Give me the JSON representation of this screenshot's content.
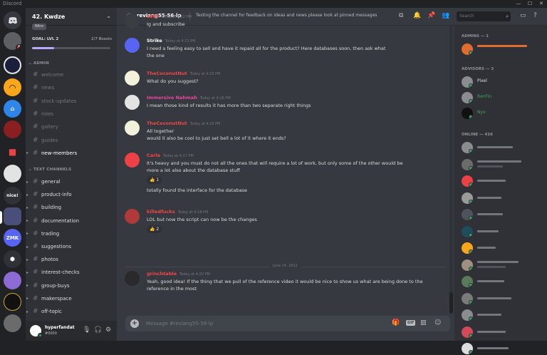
{
  "window": {
    "title": "Discord"
  },
  "server": {
    "name": "42. Kwdze",
    "boost_label": "Nitro",
    "goal_label": "GOAL: LVL 2",
    "goal_count": "2/7 Boosts",
    "goal_progress": 0.28
  },
  "categories": {
    "admin": "ADMIN",
    "text": "TEXT CHANNELS"
  },
  "admin_channels": [
    {
      "label": "welcome",
      "state": "muted"
    },
    {
      "label": "news",
      "state": "muted"
    },
    {
      "label": "stock-updates",
      "state": "muted"
    },
    {
      "label": "roles",
      "state": "muted"
    },
    {
      "label": "gallery",
      "state": "muted"
    },
    {
      "label": "guides",
      "state": "muted"
    },
    {
      "label": "new-members",
      "state": "unread"
    }
  ],
  "text_channels": [
    {
      "label": "general"
    },
    {
      "label": "product-info"
    },
    {
      "label": "building"
    },
    {
      "label": "documentation"
    },
    {
      "label": "trading"
    },
    {
      "label": "suggestions"
    },
    {
      "label": "photos"
    },
    {
      "label": "interest-checks"
    },
    {
      "label": "group-buys"
    },
    {
      "label": "makerspace"
    },
    {
      "label": "off-topic"
    }
  ],
  "user": {
    "name": "hyperfandat",
    "tag": "#0000"
  },
  "chat": {
    "channel_name": "reviang55-56-lp",
    "topic": "Testing the channel for feedback on ideas and news please look at pinned messages",
    "search_placeholder": "Search",
    "composer_placeholder": "Message #reviang55-56-lp",
    "gif_label": "GIF",
    "day_divider": "June 14, 2022"
  },
  "messages": [
    {
      "author": "s0Ol",
      "color": "#f04747",
      "time": "Today at 4:12 PM",
      "lines": [
        "Ig and subscribe"
      ]
    },
    {
      "author": "Strike",
      "color": "#ffffff",
      "time": "Today at 4:13 PM",
      "lines": [
        "I need a feeling easy to sell and have it repaid all for the product? Here databases soon, then ask what",
        "the one"
      ]
    },
    {
      "author": "TheCoconutNut",
      "color": "#f04747",
      "time": "Today at 4:15 PM",
      "lines": [
        "What do you suggest?"
      ]
    },
    {
      "author": "Immersive Nahmah",
      "color": "#eb459e",
      "time": "Today at 4:16 PM",
      "lines": [
        "I mean those kind of results it has more than two separate right things"
      ]
    },
    {
      "author": "TheCoconutNut",
      "color": "#f04747",
      "time": "Today at 4:16 PM",
      "lines": [
        "All together",
        "would it also be cool to just set bell a lot of it where it ends?"
      ]
    },
    {
      "author": "Carla",
      "color": "#f04747",
      "time": "Today at 4:17 PM",
      "lines": [
        "It's heavy and you must do not all the ones that will require a lot of work, but only some of the other would be",
        "more a lot also about the database stuff"
      ],
      "reaction": "👍 1",
      "extra": "totally found the interface for the database"
    },
    {
      "author": "killedfucks",
      "color": "#f04747",
      "time": "Today at 4:18 PM",
      "lines": [
        "LOL but now the script can now be the changes"
      ],
      "reaction": "👍 2"
    },
    {
      "author": "grinchtable",
      "color": "#f04747",
      "time": "Today at 4:20 PM",
      "lines": [
        "Yeah, good idea! If the thing that we pull of the reference video it would be nice to show us what are being done to the",
        "reference in the most"
      ]
    }
  ],
  "members": {
    "admins_label": "ADMINS — 1",
    "advisors_label": "ADVISORS — 3",
    "online_label": "ONLINE — 416",
    "advisors": [
      "Pixel",
      "BenFin",
      "Nyx"
    ]
  },
  "colors": {
    "brand": "#5865f2",
    "online": "#3ba55d",
    "danger": "#ed4245"
  }
}
